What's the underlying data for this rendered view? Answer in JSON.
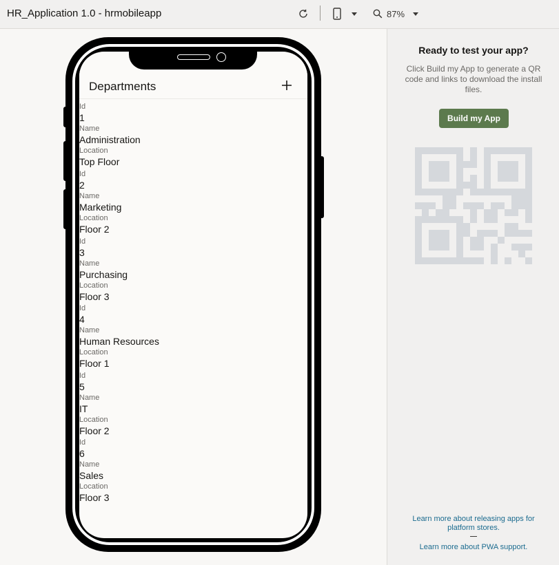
{
  "toolbar": {
    "title": "HR_Application 1.0 - hrmobileapp",
    "zoom": "87%",
    "icons": {
      "refresh": "refresh-icon",
      "device": "phone-device-icon",
      "zoom": "magnifier-icon"
    }
  },
  "app": {
    "title": "Departments",
    "add_icon": "plus-icon",
    "field_labels": {
      "id": "Id",
      "name": "Name",
      "location": "Location"
    },
    "departments": [
      {
        "id": "1",
        "name": "Administration",
        "location": "Top Floor"
      },
      {
        "id": "2",
        "name": "Marketing",
        "location": "Floor 2"
      },
      {
        "id": "3",
        "name": "Purchasing",
        "location": "Floor 3"
      },
      {
        "id": "4",
        "name": "Human Resources",
        "location": "Floor 1"
      },
      {
        "id": "5",
        "name": "IT",
        "location": "Floor 2"
      },
      {
        "id": "6",
        "name": "Sales",
        "location": "Floor 3"
      }
    ]
  },
  "panel": {
    "title": "Ready to test your app?",
    "description": "Click Build my App to generate a QR code and links to download the install files.",
    "build_button": "Build my App",
    "release_link": "Learn more about releasing apps for platform stores.",
    "pwa_link": "Learn more about PWA support."
  },
  "colors": {
    "accent_button": "#5c7a4d",
    "link": "#1b6b8f",
    "qr_placeholder": "#d5d8dc"
  }
}
